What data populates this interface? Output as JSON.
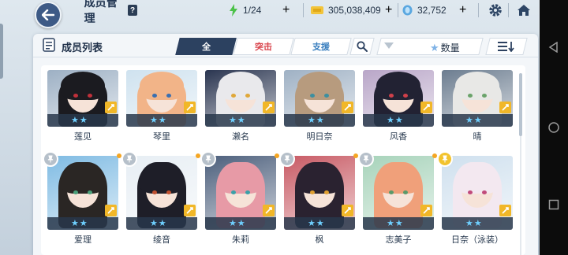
{
  "topbar": {
    "title": "成员管理",
    "help": "?",
    "ap": "1/24",
    "credits": "305,038,409",
    "gems": "32,752"
  },
  "panel": {
    "title": "成员列表",
    "tabs": [
      {
        "label": "全"
      },
      {
        "label": "突击"
      },
      {
        "label": "支援"
      }
    ],
    "sort_label": "数量"
  },
  "students": [
    {
      "name": "莲见",
      "stars": "★★",
      "hair": "#1b1b20",
      "bg": "#9db0c4",
      "eye": "#c0303a"
    },
    {
      "name": "琴里",
      "stars": "★★",
      "hair": "#f2b488",
      "bg": "#cfe2ef",
      "eye": "#3a6fb0"
    },
    {
      "name": "濑名",
      "stars": "★★",
      "hair": "#e9e9ec",
      "bg": "#2a3550",
      "eye": "#e0a83a"
    },
    {
      "name": "明日奈",
      "stars": "★★",
      "hair": "#b79b7e",
      "bg": "#9fb1c4",
      "eye": "#3c8fa0"
    },
    {
      "name": "风香",
      "stars": "★★",
      "hair": "#222233",
      "bg": "#b9a6c8",
      "eye": "#d0404a"
    },
    {
      "name": "晴",
      "stars": "★★",
      "hair": "#e8e8e6",
      "bg": "#6c7d90",
      "eye": "#6aa36a"
    },
    {
      "name": "爱理",
      "stars": "★★",
      "hair": "#2a2624",
      "bg": "#7fbbe3",
      "eye": "#4aa07a"
    },
    {
      "name": "绫音",
      "stars": "★★",
      "hair": "#1e1e28",
      "bg": "#e7eef4",
      "eye": "#c05030"
    },
    {
      "name": "朱莉",
      "stars": "★★",
      "hair": "#e79aa6",
      "bg": "#4c5f7c",
      "eye": "#3aa0a8"
    },
    {
      "name": "枫",
      "stars": "★★",
      "hair": "#2a2230",
      "bg": "#c85a64",
      "eye": "#e0a030"
    },
    {
      "name": "志美子",
      "stars": "★★",
      "hair": "#f0a07a",
      "bg": "#a7d3ba",
      "eye": "#5a9a6a"
    },
    {
      "name": "日奈（泳装）",
      "stars": "★★",
      "hair": "#f3e8f0",
      "bg": "#cfe0ee",
      "eye": "#c04a7a"
    }
  ]
}
